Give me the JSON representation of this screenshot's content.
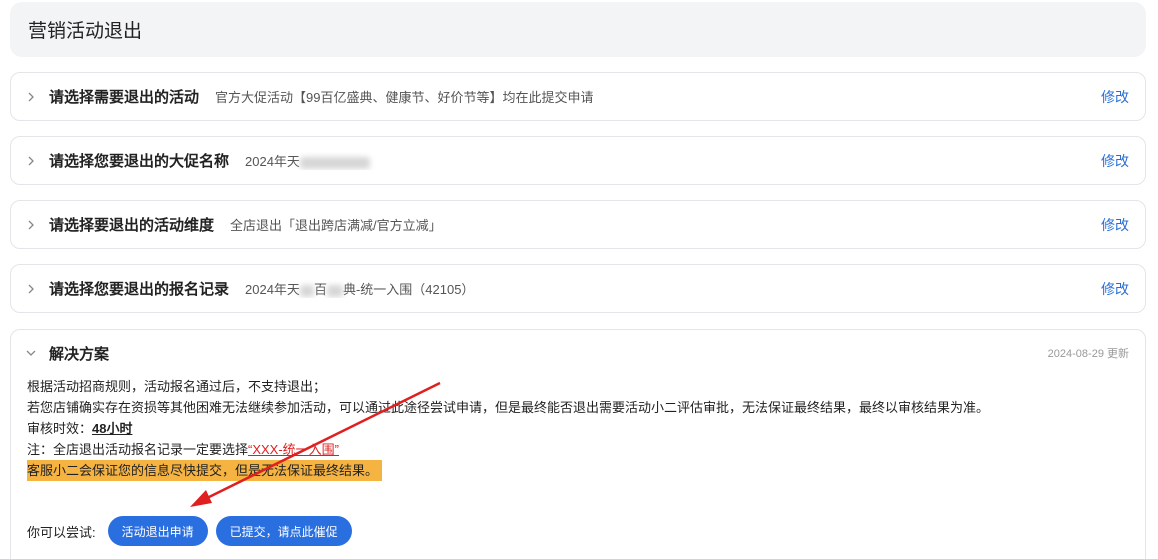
{
  "header": {
    "title": "营销活动退出"
  },
  "steps": [
    {
      "title": "请选择需要退出的活动",
      "value": "官方大促活动【99百亿盛典、健康节、好价节等】均在此提交申请",
      "edit": "修改"
    },
    {
      "title": "请选择您要退出的大促名称",
      "value_prefix": "2024年天",
      "edit": "修改"
    },
    {
      "title": "请选择要退出的活动维度",
      "value": "全店退出「退出跨店满减/官方立减」",
      "edit": "修改"
    },
    {
      "title": "请选择您要退出的报名记录",
      "value_prefix": "2024年天",
      "value_mid": "百",
      "value_suffix": "典-统一入围（42105）",
      "edit": "修改"
    }
  ],
  "solution": {
    "title": "解决方案",
    "updated": "2024-08-29 更新",
    "line1": "根据活动招商规则，活动报名通过后，不支持退出；",
    "line2": "若您店铺确实存在资损等其他困难无法继续参加活动，可以通过此途径尝试申请，但是最终能否退出需要活动小二评估审批，无法保证最终结果，最终以审核结果为准。",
    "line3_label": "审核时效：",
    "line3_value": "48小时",
    "line4_label": "注：全店退出活动报名记录一定要选择",
    "line4_link": "“XXX-统一入围”",
    "line5": "客服小二会保证您的信息尽快提交，但是无法保证最终结果。",
    "try_label": "你可以尝试:",
    "btn_apply": "活动退出申请",
    "btn_urge": "已提交，请点此催促"
  },
  "colors": {
    "accent": "#2a6fe0",
    "link": "#2a6fd6",
    "highlight": "#f5b342",
    "annotation_arrow": "#e02020"
  },
  "icons": {
    "collapsed": "chevron-right-icon",
    "expanded": "chevron-down-icon"
  }
}
